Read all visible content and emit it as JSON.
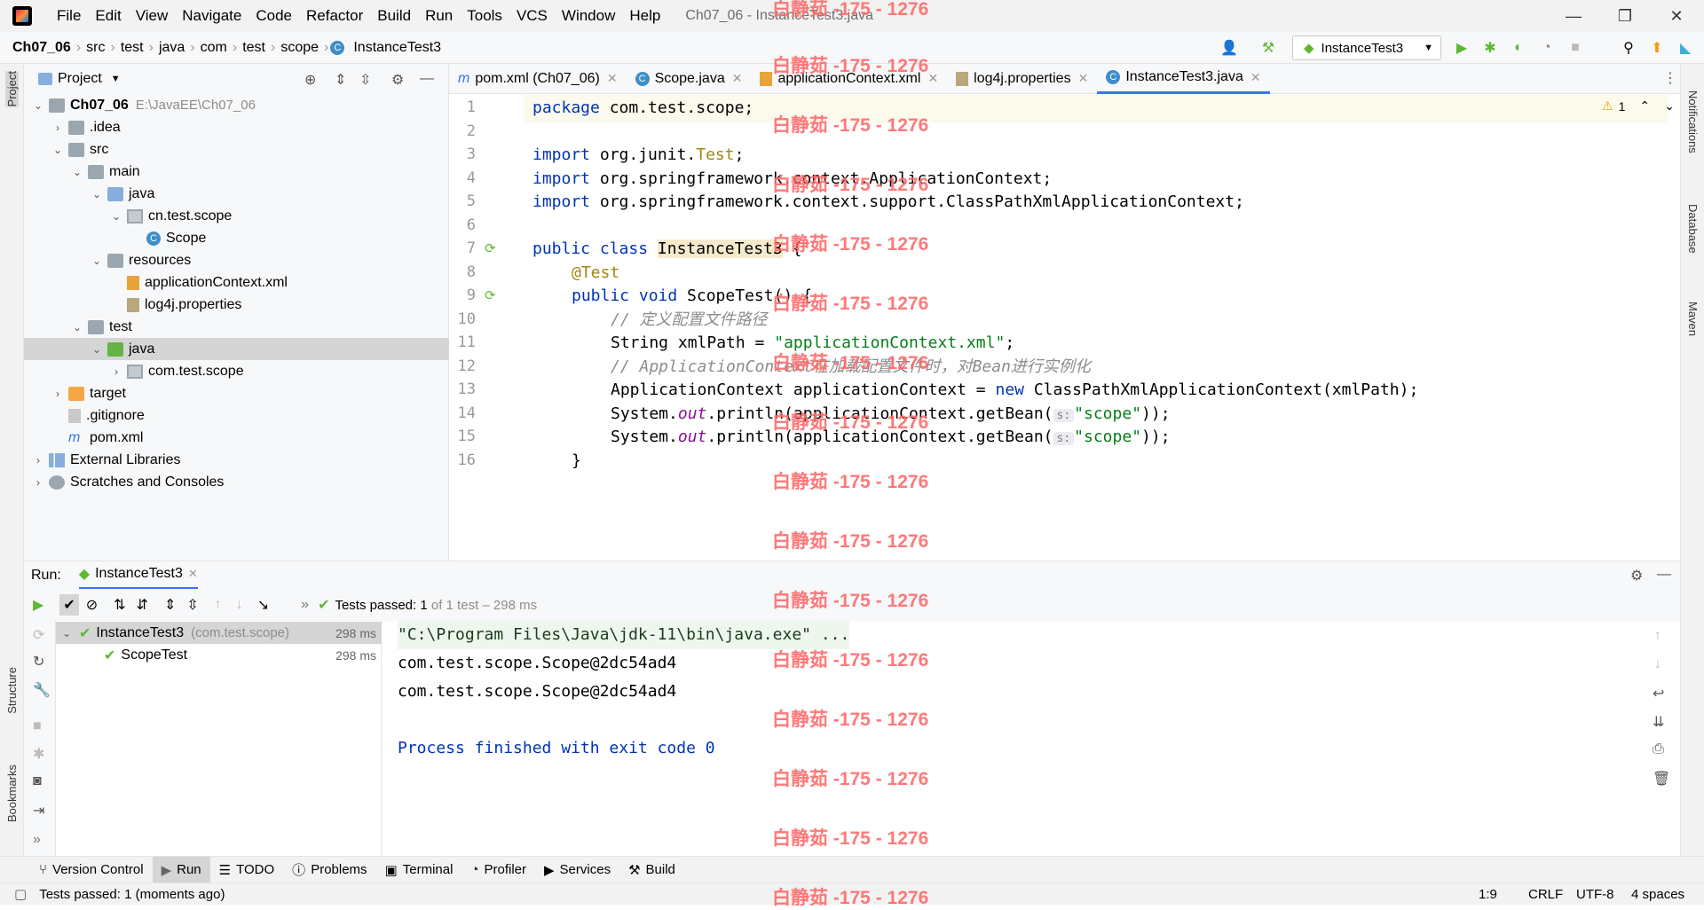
{
  "menubar": {
    "items": [
      "File",
      "Edit",
      "View",
      "Navigate",
      "Code",
      "Refactor",
      "Build",
      "Run",
      "Tools",
      "VCS",
      "Window",
      "Help"
    ],
    "title": "Ch07_06 - InstanceTest3.java"
  },
  "breadcrumb": [
    "Ch07_06",
    "src",
    "test",
    "java",
    "com",
    "test",
    "scope",
    "InstanceTest3"
  ],
  "run_config": "InstanceTest3",
  "project_panel": {
    "title": "Project",
    "tree": [
      {
        "label": "Ch07_06",
        "extra": "E:\\JavaEE\\Ch07_06",
        "indent": 0,
        "icon": "folder",
        "arrow": "down",
        "bold": true
      },
      {
        "label": ".idea",
        "indent": 1,
        "icon": "folder",
        "arrow": "right"
      },
      {
        "label": "src",
        "indent": 1,
        "icon": "folder",
        "arrow": "down"
      },
      {
        "label": "main",
        "indent": 2,
        "icon": "folder",
        "arrow": "down"
      },
      {
        "label": "java",
        "indent": 3,
        "icon": "folder-blue",
        "arrow": "down"
      },
      {
        "label": "cn.test.scope",
        "indent": 4,
        "icon": "package",
        "arrow": "down"
      },
      {
        "label": "Scope",
        "indent": 5,
        "icon": "class",
        "arrow": ""
      },
      {
        "label": "resources",
        "indent": 3,
        "icon": "folder",
        "arrow": "down"
      },
      {
        "label": "applicationContext.xml",
        "indent": 4,
        "icon": "xml",
        "arrow": ""
      },
      {
        "label": "log4j.properties",
        "indent": 4,
        "icon": "props",
        "arrow": ""
      },
      {
        "label": "test",
        "indent": 2,
        "icon": "folder",
        "arrow": "down"
      },
      {
        "label": "java",
        "indent": 3,
        "icon": "folder-green",
        "arrow": "down",
        "selected": true
      },
      {
        "label": "com.test.scope",
        "indent": 4,
        "icon": "package",
        "arrow": "right"
      },
      {
        "label": "target",
        "indent": 1,
        "icon": "folder-orange",
        "arrow": "right"
      },
      {
        "label": ".gitignore",
        "indent": 1,
        "icon": "file",
        "arrow": ""
      },
      {
        "label": "pom.xml",
        "indent": 1,
        "icon": "maven",
        "arrow": ""
      },
      {
        "label": "External Libraries",
        "indent": 0,
        "icon": "lib",
        "arrow": "right"
      },
      {
        "label": "Scratches and Consoles",
        "indent": 0,
        "icon": "scratch",
        "arrow": "right"
      }
    ]
  },
  "editor_tabs": [
    "pom.xml (Ch07_06)",
    "Scope.java",
    "applicationContext.xml",
    "log4j.properties",
    "InstanceTest3.java"
  ],
  "line_numbers": [
    "1",
    "2",
    "3",
    "4",
    "5",
    "6",
    "7",
    "8",
    "9",
    "10",
    "11",
    "12",
    "13",
    "14",
    "15",
    "16"
  ],
  "warnings_count": "1",
  "code": {
    "l1_kw": "package",
    "l1_rest": " com.test.scope;",
    "l3_kw": "import",
    "l3_a": " org.junit.",
    "l3_b": "Test",
    ";": ";",
    "l4_kw": "import",
    "l4_rest": " org.springframework.context.ApplicationContext;",
    "l5_kw": "import",
    "l5_rest": " org.springframework.context.support.ClassPathXmlApplicationContext;",
    "l7_kw": "public class ",
    "l7_name": "InstanceTest3",
    "l7_rest": " {",
    "l8": "@Test",
    "l9_kw": "public void ",
    "l9_rest": "ScopeTest() {",
    "l10": "// 定义配置文件路径",
    "l11_a": "String xmlPath = ",
    "l11_str": "\"applicationContext.xml\"",
    "l11_b": ";",
    "l12": "// ApplicationContext在加载配置文件时，对Bean进行实例化",
    "l13_a": "ApplicationContext applicationContext = ",
    "l13_kw": "new",
    "l13_b": " ClassPathXmlApplicationContext(xmlPath);",
    "l14_a": "System.",
    "l14_out": "out",
    "l14_b": ".println(applicationContext.getBean(",
    "l14_hint": "s:",
    "l14_str": "\"scope\"",
    "l14_c": "));",
    "l15_a": "System.",
    "l15_out": "out",
    "l15_b": ".println(applicationContext.getBean(",
    "l15_hint": "s:",
    "l15_str": "\"scope\"",
    "l15_c": "));",
    "l16": "}"
  },
  "run_panel": {
    "label": "Run:",
    "tab": "InstanceTest3",
    "status_bold": "Tests passed:",
    "status_count": "1",
    "status_rest": "of 1 test – 298 ms",
    "tests": [
      {
        "name": "InstanceTest3",
        "pkg": "(com.test.scope)",
        "time": "298 ms"
      },
      {
        "name": "ScopeTest",
        "time": "298 ms"
      }
    ],
    "console": [
      "\"C:\\Program Files\\Java\\jdk-11\\bin\\java.exe\" ...",
      "com.test.scope.Scope@2dc54ad4",
      "com.test.scope.Scope@2dc54ad4",
      "",
      "Process finished with exit code 0"
    ]
  },
  "bottom_tabs": [
    "Version Control",
    "Run",
    "TODO",
    "Problems",
    "Terminal",
    "Profiler",
    "Services",
    "Build"
  ],
  "statusbar": {
    "message": "Tests passed: 1 (moments ago)",
    "position": "1:9",
    "line_sep": "CRLF",
    "encoding": "UTF-8",
    "indent": "4 spaces"
  },
  "side_labels": {
    "project": "Project",
    "structure": "Structure",
    "bookmarks": "Bookmarks",
    "notifications": "Notifications",
    "database": "Database",
    "maven": "Maven"
  },
  "watermark": "白静茹 -175 - 1276"
}
